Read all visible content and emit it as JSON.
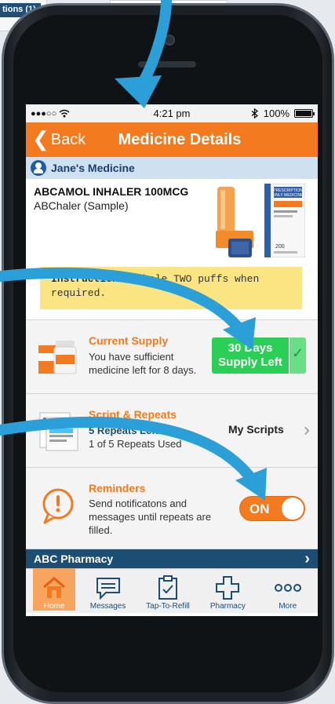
{
  "background": {
    "tab_label": "tions (1)"
  },
  "status_bar": {
    "signal": "●●●○○",
    "time": "4:21 pm",
    "battery": "100%"
  },
  "nav": {
    "back_label": "Back",
    "title": "Medicine Details"
  },
  "patient": {
    "name": "Jane's Medicine"
  },
  "medicine": {
    "name": "ABCAMOL INHALER 100MCG",
    "brand": "ABChaler (Sample)",
    "box_label": "PRESCRIPTION ONLY MEDICINE",
    "box_count": "200"
  },
  "instruction": {
    "label": "Instruction:",
    "text": "Inhale TWO puffs when required."
  },
  "supply": {
    "title": "Current Supply",
    "text_line1": "You have sufficient",
    "text_line2": "medicine left for 8 days.",
    "button_line1": "30 Days",
    "button_line2": "Supply Left"
  },
  "scripts": {
    "title": "Script & Repeats",
    "repeats_left": "5 Repeats Left",
    "repeats_used": "1 of 5 Repeats Used",
    "link": "My Scripts"
  },
  "reminders": {
    "title": "Reminders",
    "line1": "Send notificatons and",
    "line2": "messages until repeats are",
    "line3": "filled.",
    "toggle": "ON"
  },
  "pharmacy": {
    "name": "ABC Pharmacy"
  },
  "tabs": [
    {
      "label": "Home",
      "icon": "home-icon"
    },
    {
      "label": "Messages",
      "icon": "messages-icon"
    },
    {
      "label": "Tap-To-Refill",
      "icon": "refill-icon"
    },
    {
      "label": "Pharmacy",
      "icon": "pharmacy-cross-icon"
    },
    {
      "label": "More",
      "icon": "more-icon"
    }
  ],
  "colors": {
    "brand_orange": "#f47a1f",
    "supply_green": "#2bcf56",
    "navy": "#1c4d73",
    "arrow_blue": "#2a9fd8",
    "instruction_yellow": "#fbe583"
  }
}
